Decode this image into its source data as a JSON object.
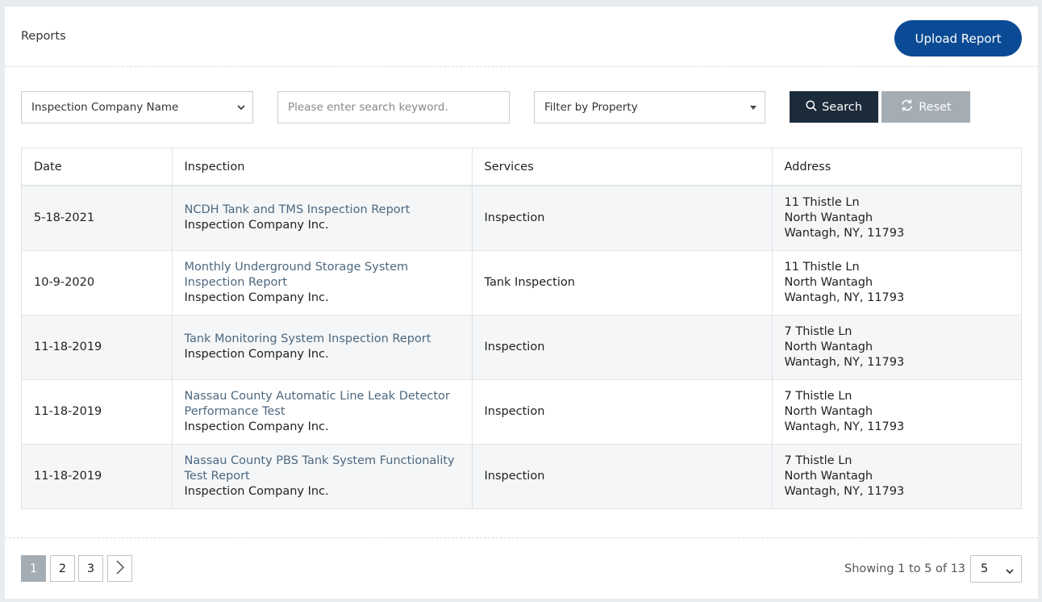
{
  "header": {
    "title": "Reports",
    "upload_label": "Upload Report"
  },
  "filters": {
    "company_select": "Inspection Company Name",
    "search_placeholder": "Please enter search keyword.",
    "property_select": "Filter by Property",
    "search_label": "Search",
    "reset_label": "Reset"
  },
  "table": {
    "columns": [
      "Date",
      "Inspection",
      "Services",
      "Address"
    ],
    "rows": [
      {
        "date": "5-18-2021",
        "inspection": "NCDH Tank and TMS Inspection Report",
        "company": "Inspection Company Inc.",
        "service": "Inspection",
        "address": [
          "11 Thistle Ln",
          "North Wantagh",
          "Wantagh, NY, 11793"
        ]
      },
      {
        "date": "10-9-2020",
        "inspection": "Monthly Underground Storage System Inspection Report",
        "company": "Inspection Company Inc.",
        "service": "Tank Inspection",
        "address": [
          "11 Thistle Ln",
          "North Wantagh",
          "Wantagh, NY, 11793"
        ]
      },
      {
        "date": "11-18-2019",
        "inspection": "Tank Monitoring System Inspection Report",
        "company": "Inspection Company Inc.",
        "service": "Inspection",
        "address": [
          "7 Thistle Ln",
          "North Wantagh",
          "Wantagh, NY, 11793"
        ]
      },
      {
        "date": "11-18-2019",
        "inspection": "Nassau County Automatic Line Leak Detector Performance Test",
        "company": "Inspection Company Inc.",
        "service": "Inspection",
        "address": [
          "7 Thistle Ln",
          "North Wantagh",
          "Wantagh, NY, 11793"
        ]
      },
      {
        "date": "11-18-2019",
        "inspection": "Nassau County PBS Tank System Functionality Test Report",
        "company": "Inspection Company Inc.",
        "service": "Inspection",
        "address": [
          "7 Thistle Ln",
          "North Wantagh",
          "Wantagh, NY, 11793"
        ]
      }
    ]
  },
  "pagination": {
    "pages": [
      "1",
      "2",
      "3"
    ],
    "active_page": "1",
    "showing": "Showing 1 to 5 of 13",
    "per_page": "5"
  },
  "icons": {
    "search": "search-icon",
    "reset": "refresh-icon",
    "next": "chevron-right-icon",
    "caret": "chevron-down-icon"
  },
  "colors": {
    "primary": "#0b4a94",
    "dark_button": "#1c2b3a",
    "muted_button": "#a5adb4",
    "link": "#4d6880"
  }
}
